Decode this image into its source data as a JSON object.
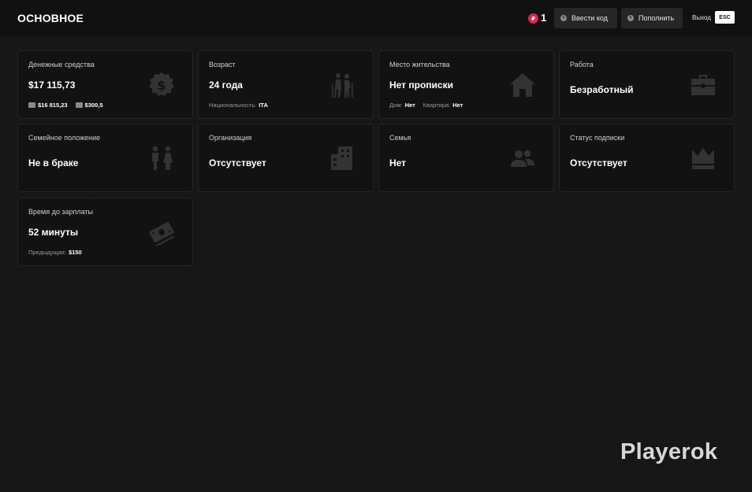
{
  "header": {
    "title": "ОСНОВНОЕ",
    "coin_count": "1",
    "enter_code_label": "Ввести код",
    "topup_label": "Пополнить",
    "exit_label": "Выход",
    "esc_key": "ESC"
  },
  "cards": {
    "money": {
      "label": "Денежные средства",
      "value": "$17 115,73",
      "cash": "$16 815,23",
      "bank": "$300,5",
      "icon": "dollar-coin-icon"
    },
    "age": {
      "label": "Возраст",
      "value": "24 года",
      "nationality_label": "Национальность:",
      "nationality": "ITA",
      "icon": "elderly-couple-icon"
    },
    "residence": {
      "label": "Место жительства",
      "value": "Нет прописки",
      "house_label": "Дом:",
      "house": "Нет",
      "apartment_label": "Квартира:",
      "apartment": "Нет",
      "icon": "house-icon"
    },
    "job": {
      "label": "Работа",
      "value": "Безработный",
      "icon": "briefcase-icon"
    },
    "marital": {
      "label": "Семейное положение",
      "value": "Не в браке",
      "icon": "man-woman-icon"
    },
    "organization": {
      "label": "Организация",
      "value": "Отсутствует",
      "icon": "building-icon"
    },
    "family": {
      "label": "Семья",
      "value": "Нет",
      "icon": "users-icon"
    },
    "subscription": {
      "label": "Статус подписки",
      "value": "Отсутствует",
      "icon": "crown-icon"
    },
    "salary": {
      "label": "Время до зарплаты",
      "value": "52 минуты",
      "previous_label": "Предыдущая:",
      "previous": "$150",
      "icon": "money-bills-icon"
    }
  },
  "watermark": "Playerok",
  "colors": {
    "background": "#161616",
    "card": "#121212",
    "coin": "#d8264f"
  }
}
